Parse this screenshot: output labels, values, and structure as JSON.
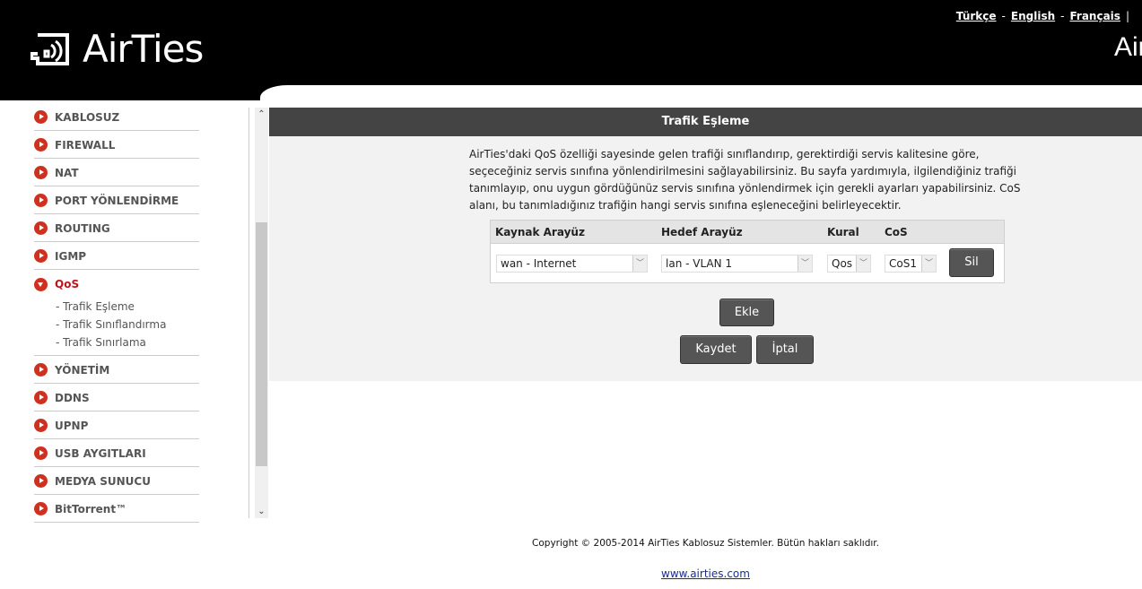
{
  "header": {
    "logo": "AirTies",
    "brand_right": "AirTies",
    "languages": [
      "Türkçe",
      "English",
      "Français"
    ]
  },
  "sidebar": {
    "items": [
      "KABLOSUZ",
      "FIREWALL",
      "NAT",
      "PORT YÖNLENDİRME",
      "ROUTING",
      "IGMP",
      "QoS",
      "YÖNETİM",
      "DDNS",
      "UPNP",
      "USB AYGITLARI",
      "MEDYA SUNUCU",
      "BitTorrent™"
    ],
    "active": "QoS",
    "qos_subitems": [
      "- Trafik Eşleme",
      "- Trafik Sınıflandırma",
      "- Trafik Sınırlama"
    ]
  },
  "panel": {
    "title": "Trafik Eşleme",
    "description": "AirTies'daki QoS özelliği sayesinde gelen trafiği sınıflandırıp, gerektirdiği servis kalitesine göre, seçeceğiniz servis sınıfına yönlendirilmesini sağlayabilirsiniz. Bu sayfa yardımıyla, ilgilendiğiniz trafiği tanımlayıp, onu uygun gördüğünüz servis sınıfına yönlendirmek için gerekli ayarları yapabilirsiniz. CoS alanı, bu tanımladığınız trafiğin hangi servis sınıfına eşleneceğini belirleyecektir.",
    "table": {
      "headers": [
        "Kaynak Arayüz",
        "Hedef Arayüz",
        "Kural",
        "CoS"
      ],
      "row": {
        "source": "wan - Internet",
        "target": "lan - VLAN 1",
        "rule": "Qos",
        "cos": "CoS1",
        "delete": "Sil"
      }
    },
    "add": "Ekle",
    "save": "Kaydet",
    "cancel": "İptal"
  },
  "footer": {
    "copyright": "Copyright © 2005-2014 AirTies Kablosuz Sistemler. Bütün hakları saklıdır.",
    "link": "www.airties.com"
  },
  "colors": {
    "accent": "#d0311f",
    "header": "#000000",
    "titlebar": "#444444"
  }
}
